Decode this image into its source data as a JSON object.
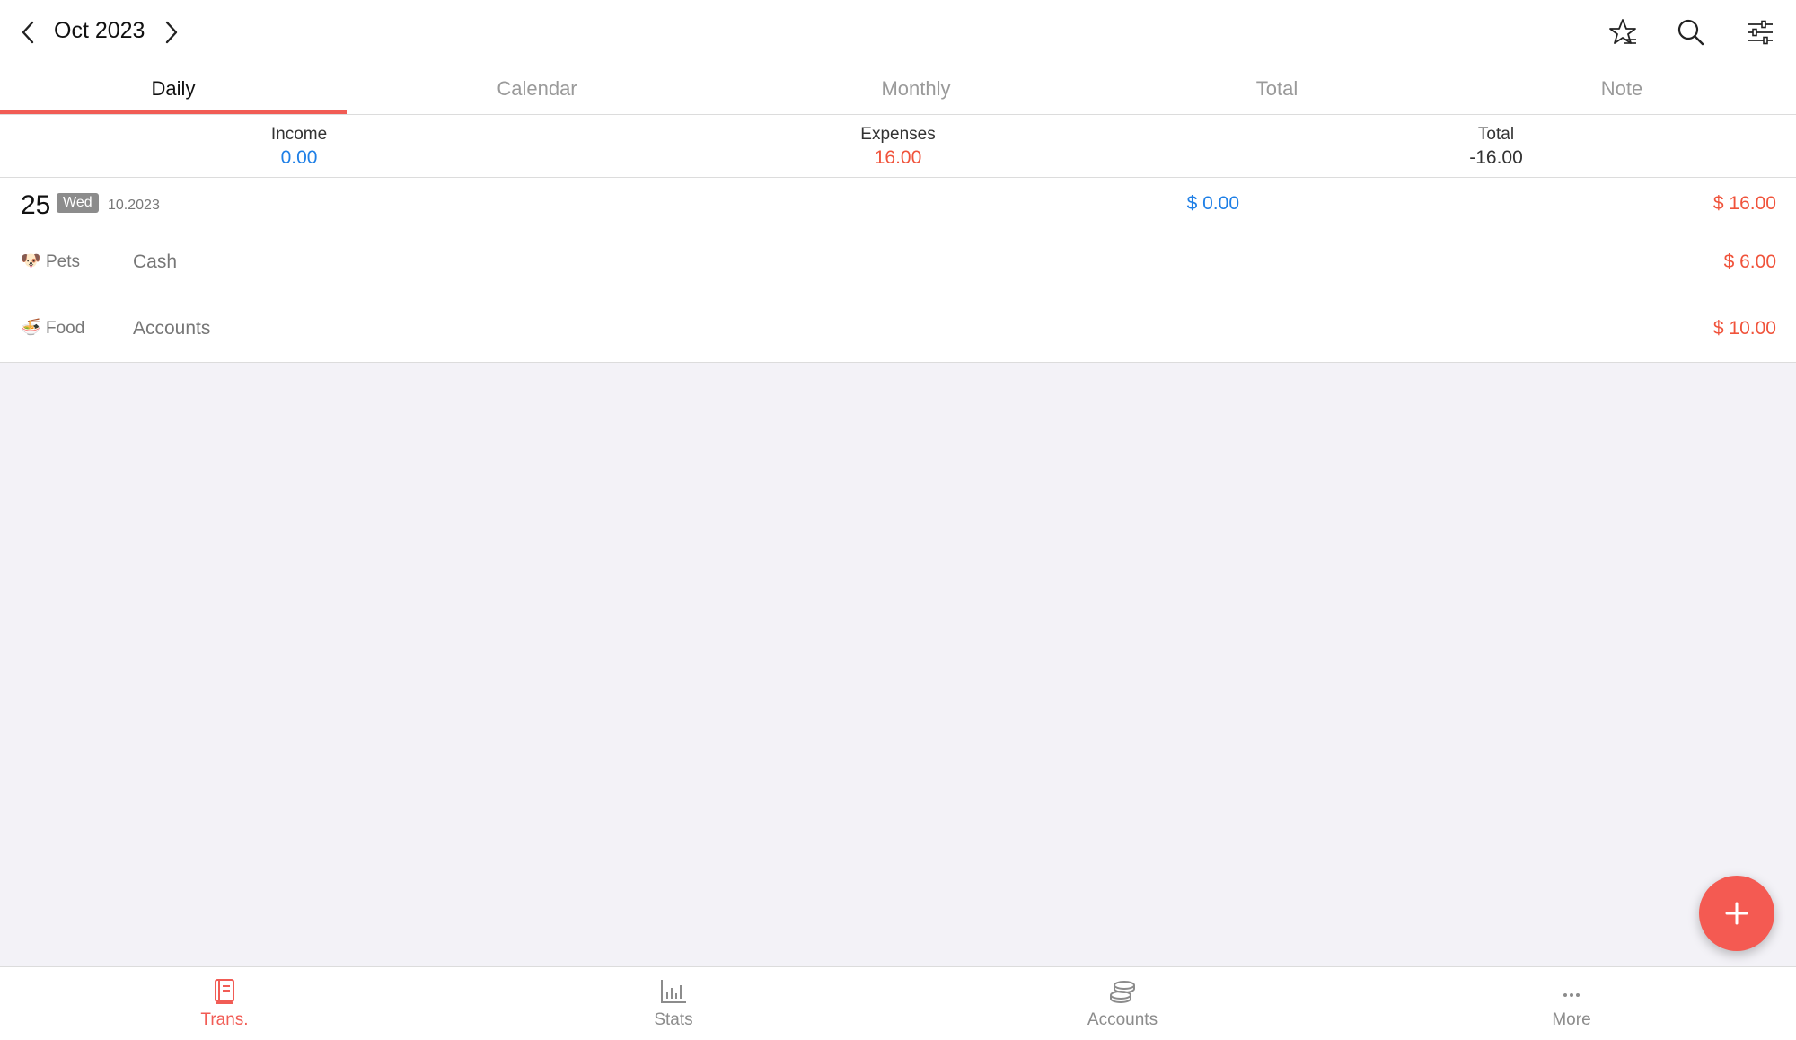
{
  "header": {
    "month_title": "Oct 2023",
    "icons": [
      "chevron-left-icon",
      "chevron-right-icon",
      "bookmark-star-icon",
      "search-icon",
      "filter-sliders-icon"
    ]
  },
  "tabs": [
    {
      "label": "Daily",
      "active": true
    },
    {
      "label": "Calendar",
      "active": false
    },
    {
      "label": "Monthly",
      "active": false
    },
    {
      "label": "Total",
      "active": false
    },
    {
      "label": "Note",
      "active": false
    }
  ],
  "summary": {
    "income_label": "Income",
    "income_value": "0.00",
    "expenses_label": "Expenses",
    "expenses_value": "16.00",
    "total_label": "Total",
    "total_value": "-16.00"
  },
  "day_group": {
    "day": "25",
    "weekday": "Wed",
    "month_year": "10.2023",
    "income": "$ 0.00",
    "expense": "$ 16.00",
    "transactions": [
      {
        "emoji": "🐶",
        "category": "Pets",
        "account": "Cash",
        "amount": "$ 6.00"
      },
      {
        "emoji": "🍜",
        "category": "Food",
        "account": "Accounts",
        "amount": "$ 10.00"
      }
    ]
  },
  "bottom_nav": [
    {
      "label": "Trans.",
      "icon": "book-icon",
      "active": true
    },
    {
      "label": "Stats",
      "icon": "bar-chart-icon",
      "active": false
    },
    {
      "label": "Accounts",
      "icon": "coins-icon",
      "active": false
    },
    {
      "label": "More",
      "icon": "more-dots-icon",
      "active": false
    }
  ],
  "colors": {
    "accent": "#f15c55",
    "income": "#1e7fe6",
    "expense": "#f0533b",
    "fab": "#f45a52"
  }
}
